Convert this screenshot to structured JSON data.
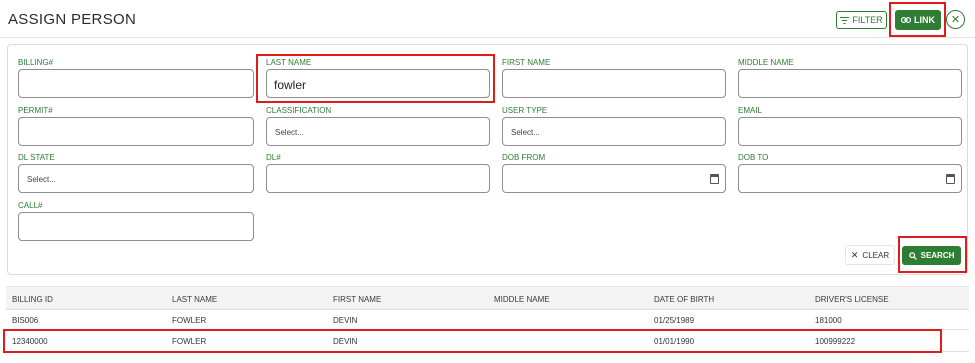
{
  "header": {
    "title": "ASSIGN PERSON",
    "filter_label": "FILTER",
    "link_label": "LINK",
    "close_glyph": "✕"
  },
  "form": {
    "billing": {
      "label": "BILLING#",
      "value": ""
    },
    "last_name": {
      "label": "LAST NAME",
      "value": "fowler"
    },
    "first_name": {
      "label": "FIRST NAME",
      "value": ""
    },
    "middle_name": {
      "label": "MIDDLE NAME",
      "value": ""
    },
    "permit": {
      "label": "PERMIT#",
      "value": ""
    },
    "classification": {
      "label": "CLASSIFICATION",
      "selected": "Select..."
    },
    "user_type": {
      "label": "USER TYPE",
      "selected": "Select..."
    },
    "email": {
      "label": "EMAIL",
      "value": ""
    },
    "dl_state": {
      "label": "DL STATE",
      "selected": "Select..."
    },
    "dl": {
      "label": "DL#",
      "value": ""
    },
    "dob_from": {
      "label": "DOB FROM",
      "value": ""
    },
    "dob_to": {
      "label": "DOB TO",
      "value": ""
    },
    "call": {
      "label": "CALL#",
      "value": ""
    },
    "clear_label": "CLEAR",
    "search_label": "SEARCH"
  },
  "table": {
    "columns": [
      "BILLING ID",
      "LAST NAME",
      "FIRST NAME",
      "MIDDLE NAME",
      "DATE OF BIRTH",
      "DRIVER'S LICENSE"
    ],
    "rows": [
      [
        "BIS006",
        "FOWLER",
        "DEVIN",
        "",
        "01/25/1989",
        "181000"
      ],
      [
        "12340000",
        "FOWLER",
        "DEVIN",
        "",
        "01/01/1990",
        "100999222"
      ]
    ]
  },
  "colors": {
    "accent": "#2e7d32",
    "highlight": "#e01b1b"
  },
  "icons": [
    "filter-icon",
    "link-icon",
    "close-icon",
    "calendar-icon",
    "search-icon"
  ]
}
